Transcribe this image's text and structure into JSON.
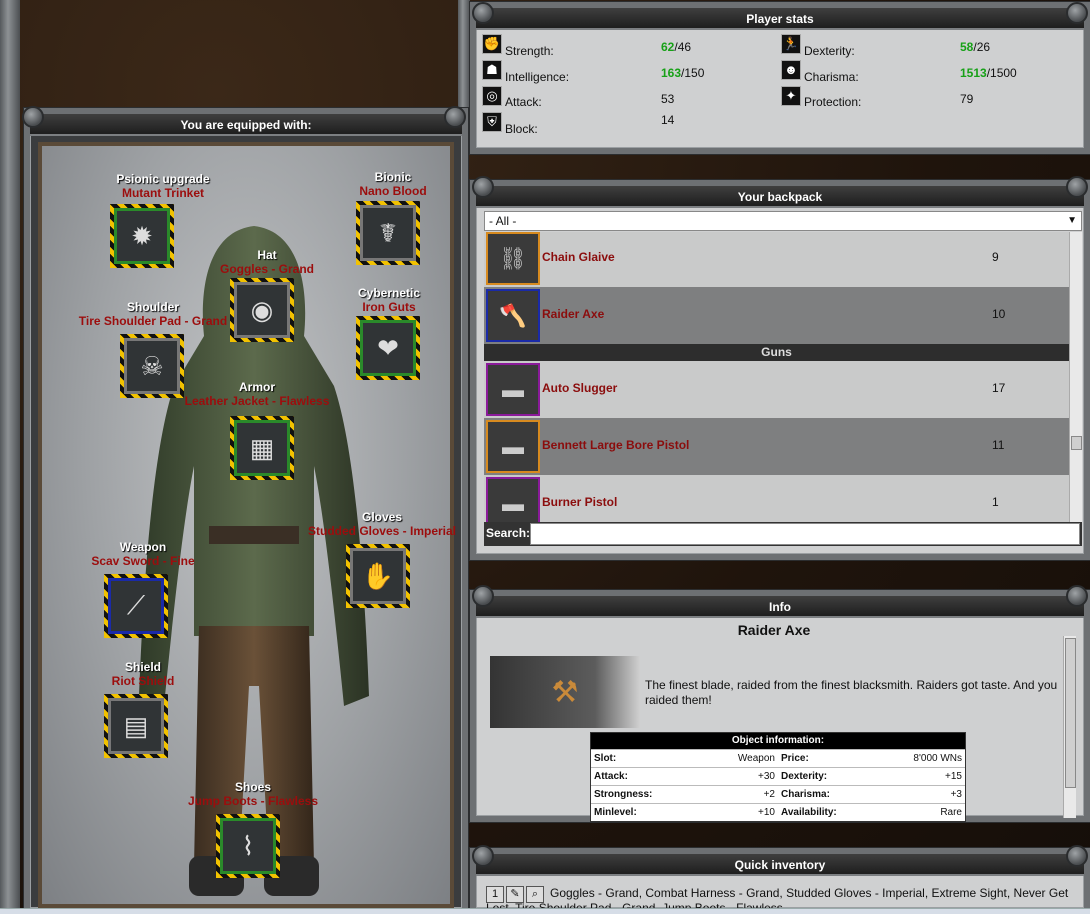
{
  "equipment": {
    "title": "You are equipped with:",
    "slots": [
      {
        "label": "Psionic upgrade",
        "name": "Mutant Trinket",
        "icon": "✹"
      },
      {
        "label": "Bionic",
        "name": "Nano Blood",
        "icon": "☤"
      },
      {
        "label": "Hat",
        "name": "Goggles - Grand",
        "icon": "◉"
      },
      {
        "label": "Cybernetic",
        "name": "Iron Guts",
        "icon": "❤"
      },
      {
        "label": "Shoulder",
        "name": "Tire Shoulder Pad - Grand",
        "icon": "☠"
      },
      {
        "label": "Armor",
        "name": "Leather Jacket - Flawless",
        "icon": "▦"
      },
      {
        "label": "Gloves",
        "name": "Studded Gloves - Imperial",
        "icon": "✋"
      },
      {
        "label": "Weapon",
        "name": "Scav Sword - Fine",
        "icon": "⟋"
      },
      {
        "label": "Shield",
        "name": "Riot Shield",
        "icon": "▤"
      },
      {
        "label": "Shoes",
        "name": "Jump Boots - Flawless",
        "icon": "⌇"
      }
    ]
  },
  "stats": {
    "title": "Player stats",
    "rows": [
      {
        "icon": "strength-icon",
        "glyph": "✊",
        "label": "Strength:",
        "value": "62",
        "max": "/46",
        "green": true
      },
      {
        "icon": "dexterity-icon",
        "glyph": "🏃",
        "label": "Dexterity:",
        "value": "58",
        "max": "/26",
        "green": true
      },
      {
        "icon": "intelligence-icon",
        "glyph": "☗",
        "label": "Intelligence:",
        "value": "163",
        "max": "/150",
        "green": true
      },
      {
        "icon": "charisma-icon",
        "glyph": "☻",
        "label": "Charisma:",
        "value": "1513",
        "max": "/1500",
        "green": true
      },
      {
        "icon": "attack-icon",
        "glyph": "◎",
        "label": "Attack:",
        "value": "53",
        "max": "",
        "green": false
      },
      {
        "icon": "protection-icon",
        "glyph": "✦",
        "label": "Protection:",
        "value": "79",
        "max": "",
        "green": false
      },
      {
        "icon": "block-icon",
        "glyph": "⛨",
        "label": "Block:",
        "value": "14",
        "max": "",
        "green": false
      }
    ]
  },
  "backpack": {
    "title": "Your backpack",
    "filter": "- All -",
    "items": [
      {
        "name": "Chain Glaive",
        "qty": "9",
        "icon": "⛓"
      },
      {
        "name": "Raider Axe",
        "qty": "10",
        "icon": "🪓"
      },
      {
        "category": "Guns"
      },
      {
        "name": "Auto Slugger",
        "qty": "17",
        "icon": "▬"
      },
      {
        "name": "Bennett Large Bore Pistol",
        "qty": "11",
        "icon": "▬"
      },
      {
        "name": "Burner Pistol",
        "qty": "1",
        "icon": "▬"
      }
    ],
    "search_label": "Search:"
  },
  "info": {
    "title": "Info",
    "item_name": "Raider Axe",
    "description": "The finest blade, raided from the finest blacksmith. Raiders got taste. And you raided them!",
    "table_title": "Object information:",
    "rows": [
      [
        "Slot:",
        "Weapon",
        "Price:",
        "8'000 WNs"
      ],
      [
        "Attack:",
        "+30",
        "Dexterity:",
        "+15"
      ],
      [
        "Strongness:",
        "+2",
        "Charisma:",
        "+3"
      ],
      [
        "Minlevel:",
        "+10",
        "Availability:",
        "Rare"
      ]
    ]
  },
  "quick": {
    "title": "Quick inventory",
    "text": "Goggles - Grand, Combat Harness - Grand, Studded Gloves - Imperial, Extreme Sight, Never Get Lost, Tire Shoulder Pad - Grand, Jump Boots - Flawless"
  }
}
